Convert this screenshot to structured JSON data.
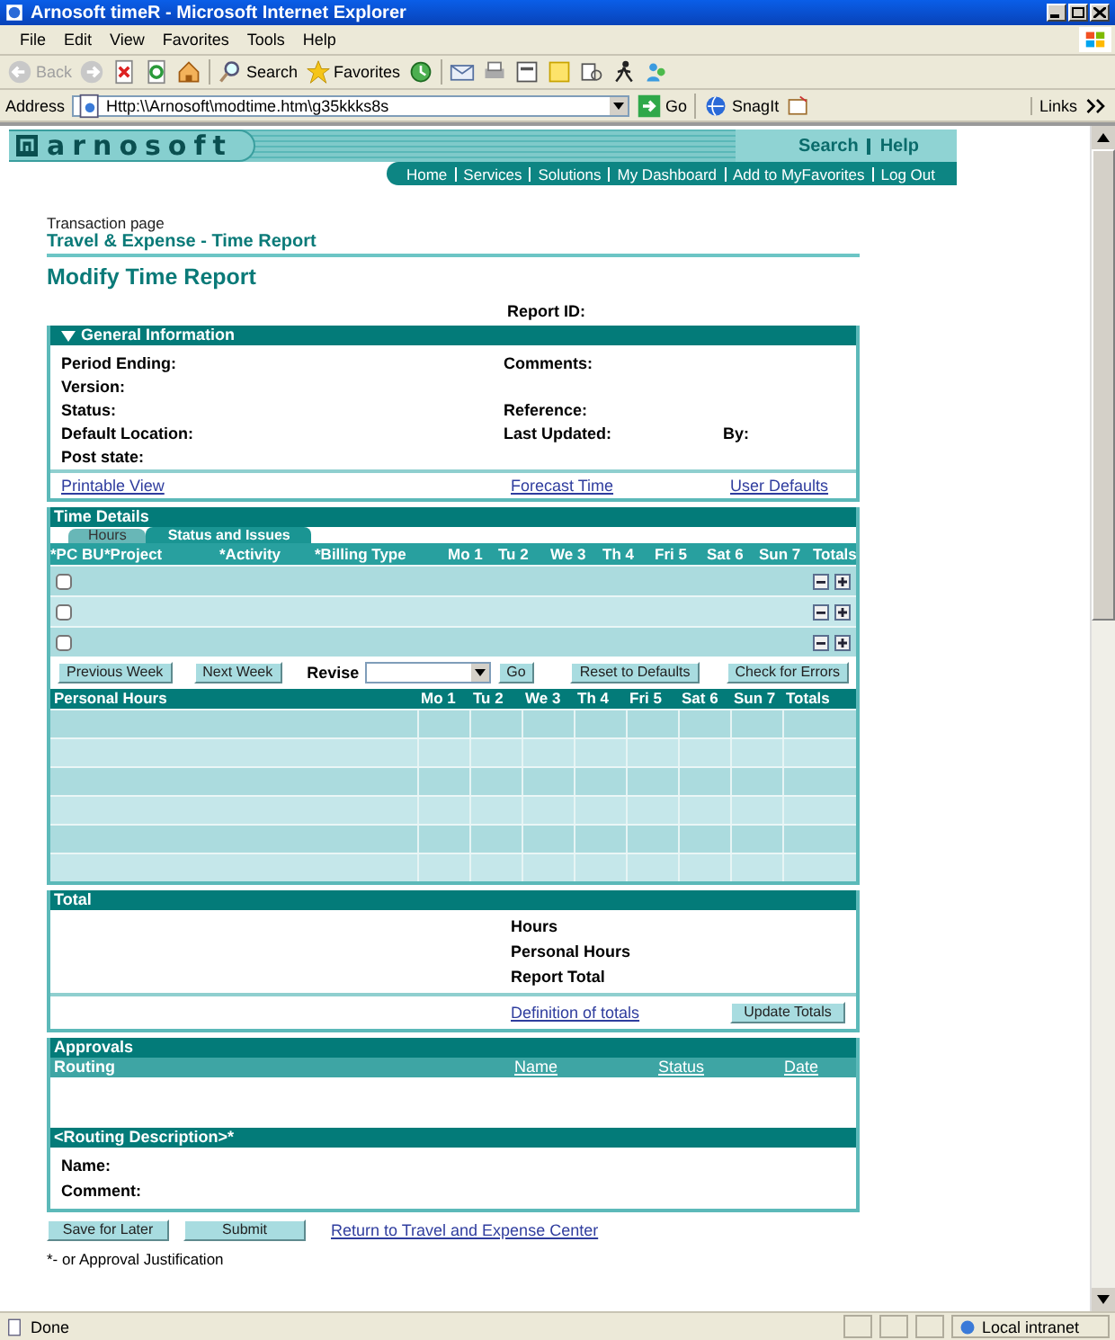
{
  "window": {
    "title": "Arnosoft timeR - Microsoft Internet Explorer"
  },
  "menu": [
    "File",
    "Edit",
    "View",
    "Favorites",
    "Tools",
    "Help"
  ],
  "toolbar": {
    "back": "Back",
    "search": "Search",
    "favorites": "Favorites"
  },
  "address": {
    "label": "Address",
    "value": "Http:\\\\Arnosoft\\modtime.htm\\g35kkks8s",
    "go": "Go",
    "snagit": "SnagIt",
    "links": "Links"
  },
  "site": {
    "logo": "arnosoft",
    "utility": [
      "Search",
      "Help"
    ],
    "nav": [
      "Home",
      "Services",
      "Solutions",
      "My Dashboard",
      "Add to MyFavorites",
      "Log Out"
    ]
  },
  "breadcrumb": "Transaction page",
  "section_title": "Travel & Expense - Time Report",
  "page_title": "Modify Time Report",
  "report_id": "Report ID:",
  "general": {
    "title": "General Information",
    "expanded": true,
    "rows": [
      [
        "Period Ending:",
        "Comments:"
      ],
      [
        "Version:"
      ],
      [
        "Status:",
        "Reference:"
      ],
      [
        "Default Location:",
        "Last Updated:",
        "By:"
      ],
      [
        "Post state:"
      ]
    ],
    "links": [
      "Printable View",
      "Forecast Time",
      "User Defaults"
    ]
  },
  "time_details": {
    "title": "Time Details",
    "tabs": [
      {
        "label": "Hours",
        "selected": false
      },
      {
        "label": "Status and Issues",
        "selected": true
      }
    ],
    "columns": [
      "*PC BU",
      "*Project",
      "*Activity",
      "*Billing Type",
      "Mo 1",
      "Tu 2",
      "We 3",
      "Th 4",
      "Fri 5",
      "Sat 6",
      "Sun 7",
      "Totals"
    ],
    "rows": [
      {
        "checked": false
      },
      {
        "checked": false
      },
      {
        "checked": false
      }
    ],
    "buttons": [
      "Previous Week",
      "Next Week"
    ],
    "revise_label": "Revise",
    "go": "Go",
    "actions": [
      "Reset to Defaults",
      "Check for Errors"
    ]
  },
  "personal_hours": {
    "title": "Personal Hours",
    "columns": [
      "Mo 1",
      "Tu 2",
      "We 3",
      "Th 4",
      "Fri 5",
      "Sat 6",
      "Sun 7",
      "Totals"
    ]
  },
  "total": {
    "title": "Total",
    "labels": [
      "Hours",
      "Personal Hours",
      "Report Total"
    ],
    "link": "Definition of totals",
    "button": "Update Totals"
  },
  "approvals": {
    "title": "Approvals",
    "columns": [
      "Routing",
      "Name",
      "Status",
      "Date"
    ],
    "routing_title": "<Routing Description>*",
    "fields": [
      "Name:",
      "Comment:"
    ]
  },
  "actions": [
    "Save for Later",
    "Submit"
  ],
  "return_link": "Return to Travel and Expense Center",
  "footnote": "*- or Approval Justification",
  "status_bar": {
    "text": "Done",
    "zone": "Local intranet"
  }
}
